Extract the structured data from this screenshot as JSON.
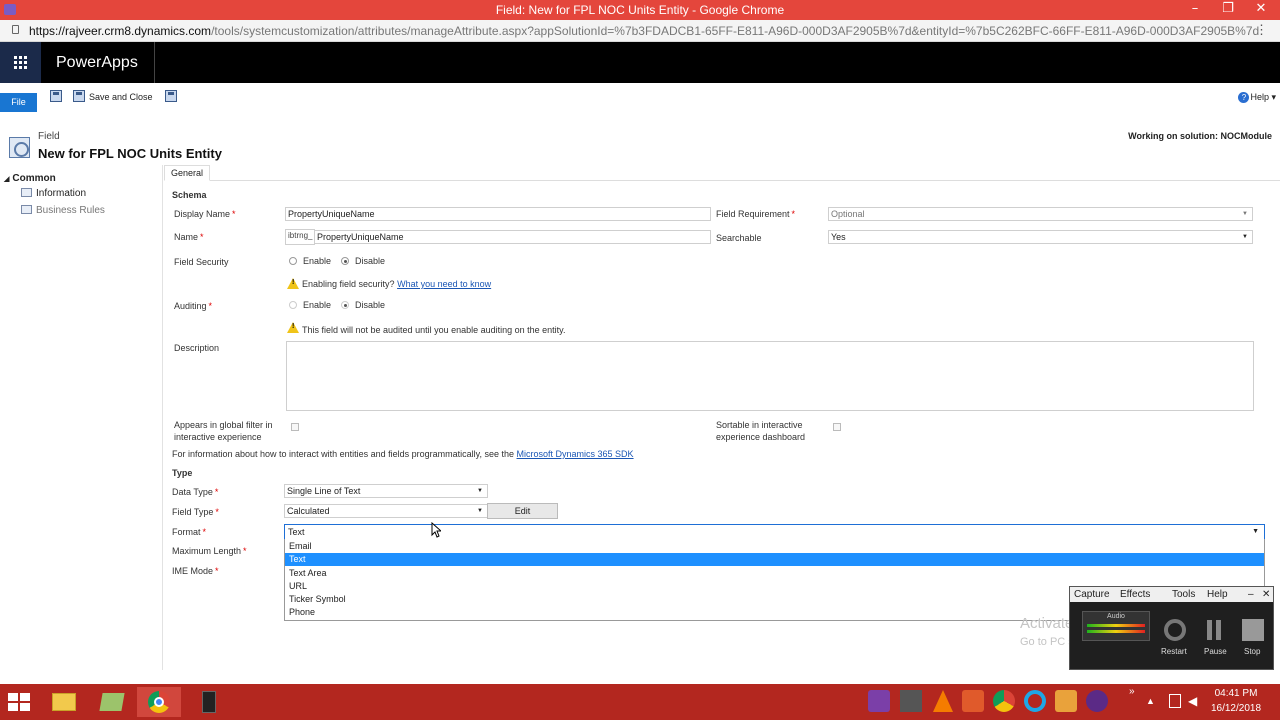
{
  "window": {
    "title": "Field: New for FPL NOC Units Entity - Google Chrome"
  },
  "address": {
    "host": "https://rajveer.crm8.dynamics.com",
    "path": "/tools/systemcustomization/attributes/manageAttribute.aspx?appSolutionId=%7b3FDADCB1-65FF-E811-A96D-000D3AF2905B%7d&entityId=%7b5C262BFC-66FF-E811-A96D-000D3AF2905B%7d"
  },
  "app": {
    "brand": "PowerApps"
  },
  "ribbon": {
    "file": "File",
    "save_close": "Save and Close",
    "help": "Help"
  },
  "page": {
    "crumb": "Field",
    "title": "New for FPL NOC Units Entity",
    "solution": "Working on solution: NOCModule"
  },
  "nav": {
    "header": "Common",
    "items": [
      {
        "label": "Information"
      },
      {
        "label": "Business Rules"
      }
    ]
  },
  "tabs": [
    {
      "label": "General"
    }
  ],
  "form": {
    "schema_heading": "Schema",
    "display_name": {
      "label": "Display Name",
      "value": "PropertyUniqueName"
    },
    "name": {
      "label": "Name",
      "prefix": "ibtrng_",
      "value": "PropertyUniqueName"
    },
    "field_requirement": {
      "label": "Field Requirement",
      "value": "Optional"
    },
    "searchable": {
      "label": "Searchable",
      "value": "Yes"
    },
    "field_security": {
      "label": "Field Security",
      "options": [
        "Enable",
        "Disable"
      ],
      "selected": "Disable"
    },
    "security_warning": "Enabling field security?",
    "security_link": "What you need to know",
    "auditing": {
      "label": "Auditing",
      "options": [
        "Enable",
        "Disable"
      ],
      "selected": "Disable"
    },
    "audit_warning": "This field will not be audited until you enable auditing on the entity.",
    "description": {
      "label": "Description",
      "value": ""
    },
    "global_filter": {
      "label_line1": "Appears in global filter in",
      "label_line2": "interactive experience",
      "checked": false
    },
    "sortable": {
      "label_line1": "Sortable in interactive",
      "label_line2": "experience dashboard",
      "checked": false
    },
    "sdk_text": "For information about how to interact with entities and fields programmatically, see the",
    "sdk_link": "Microsoft Dynamics 365 SDK",
    "type_heading": "Type",
    "data_type": {
      "label": "Data Type",
      "value": "Single Line of Text"
    },
    "field_type": {
      "label": "Field Type",
      "value": "Calculated",
      "edit": "Edit"
    },
    "format": {
      "label": "Format",
      "value": "Text",
      "options": [
        "Email",
        "Text",
        "Text Area",
        "URL",
        "Ticker Symbol",
        "Phone"
      ],
      "highlighted": "Text"
    },
    "max_length": {
      "label": "Maximum Length"
    },
    "ime_mode": {
      "label": "IME Mode"
    }
  },
  "watermark": {
    "line1": "Activate Windows",
    "line2": "Go to PC settings to activate Windows."
  },
  "recorder": {
    "menu": [
      "Capture",
      "Effects",
      "Tools",
      "Help"
    ],
    "audio": "Audio",
    "restart": "Restart",
    "pause": "Pause",
    "stop": "Stop"
  },
  "clock": {
    "time": "04:41 PM",
    "date": "16/12/2018"
  },
  "colors": {
    "titlebar": "#e4463c",
    "taskbar": "#b3271f",
    "accent": "#1976d2",
    "highlight": "#1e90ff"
  }
}
